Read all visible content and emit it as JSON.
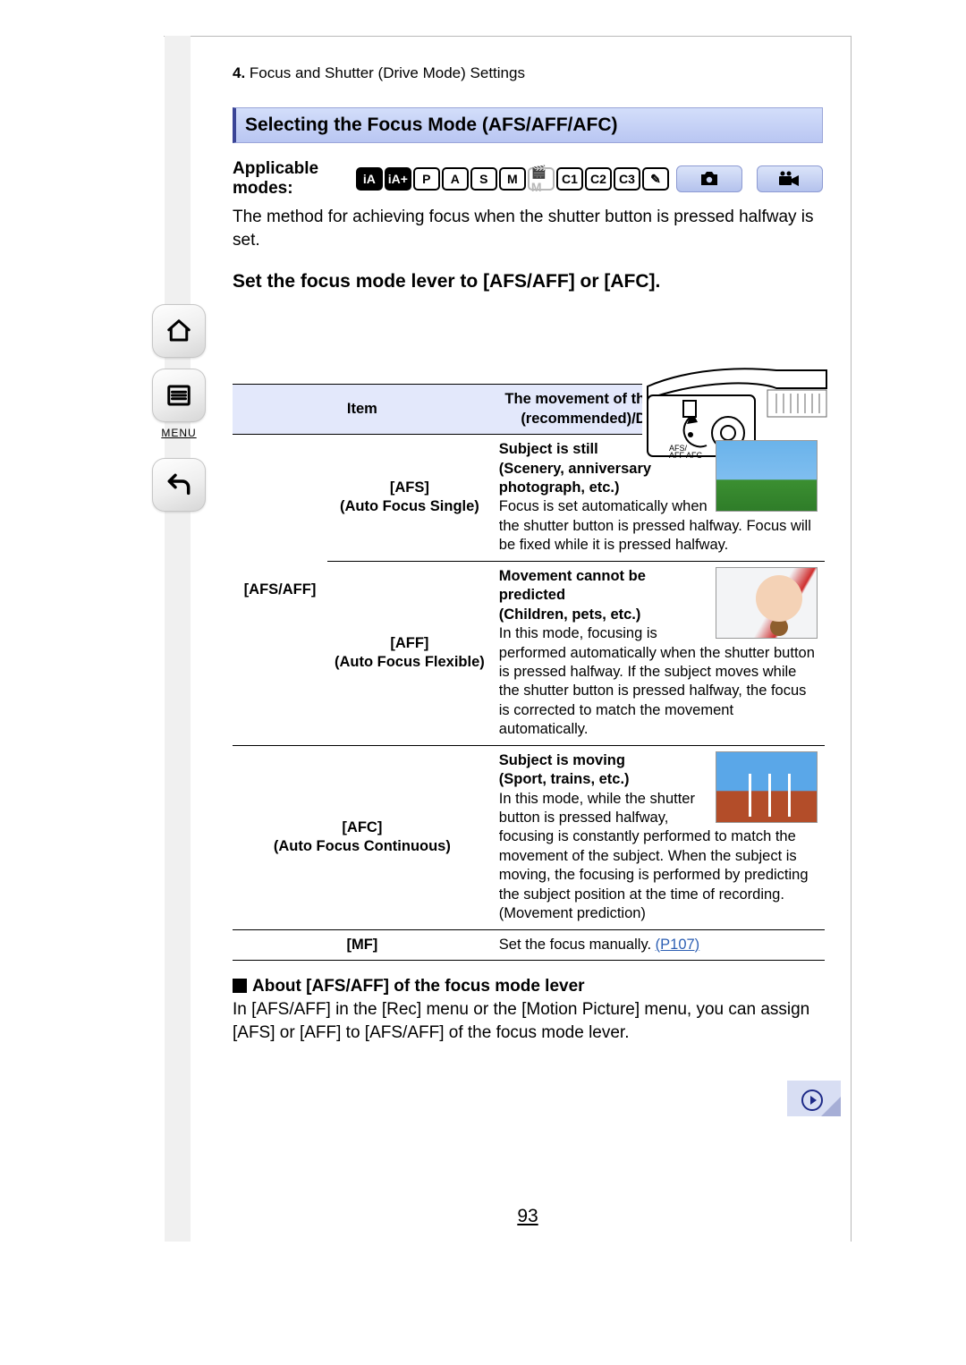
{
  "sidebar": {
    "menu_label": "MENU"
  },
  "chapter": {
    "number": "4.",
    "title": "Focus and Shutter (Drive Mode) Settings"
  },
  "section": {
    "heading": "Selecting the Focus Mode (AFS/AFF/AFC)",
    "applicable_label": "Applicable modes:",
    "mode_chips": [
      "iA",
      "iA+",
      "P",
      "A",
      "S",
      "M",
      "🎬M",
      "C1",
      "C2",
      "C3",
      "✎"
    ],
    "lead": "The method for achieving focus when the shutter button is pressed halfway is set.",
    "instruction": "Set the focus mode lever to [AFS/AFF] or [AFC]."
  },
  "table": {
    "headers": {
      "item": "Item",
      "desc": "The movement of the subject and the scene (recommended)/Description of settings"
    },
    "group_label": "[AFS/AFF]",
    "rows": {
      "afs": {
        "name": "[AFS]",
        "subname": "(Auto Focus Single)",
        "title": "Subject is still",
        "subtitle": "(Scenery, anniversary photograph, etc.)",
        "body": "Focus is set automatically when the shutter button is pressed halfway. Focus will be fixed while it is pressed halfway."
      },
      "aff": {
        "name": "[AFF]",
        "subname": "(Auto Focus Flexible)",
        "title": "Movement cannot be predicted",
        "subtitle": "(Children, pets, etc.)",
        "body": "In this mode, focusing is performed automatically when the shutter button is pressed halfway. If the subject moves while the shutter button is pressed halfway, the focus is corrected to match the movement automatically."
      },
      "afc": {
        "name": "[AFC]",
        "subname": "(Auto Focus Continuous)",
        "title": "Subject is moving",
        "subtitle": "(Sport, trains, etc.)",
        "body": "In this mode, while the shutter button is pressed halfway, focusing is constantly performed to match the movement of the subject. When the subject is moving, the focusing is performed by predicting the subject position at the time of recording. (Movement prediction)"
      },
      "mf": {
        "name": "[MF]",
        "body_prefix": "Set the focus manually. ",
        "link_text": "(P107)"
      }
    }
  },
  "about": {
    "heading": "About [AFS/AFF] of the focus mode lever",
    "body": "In [AFS/AFF] in the [Rec] menu or the [Motion Picture] menu, you can assign [AFS] or [AFF] to [AFS/AFF] of the focus mode lever."
  },
  "page_number": "93"
}
